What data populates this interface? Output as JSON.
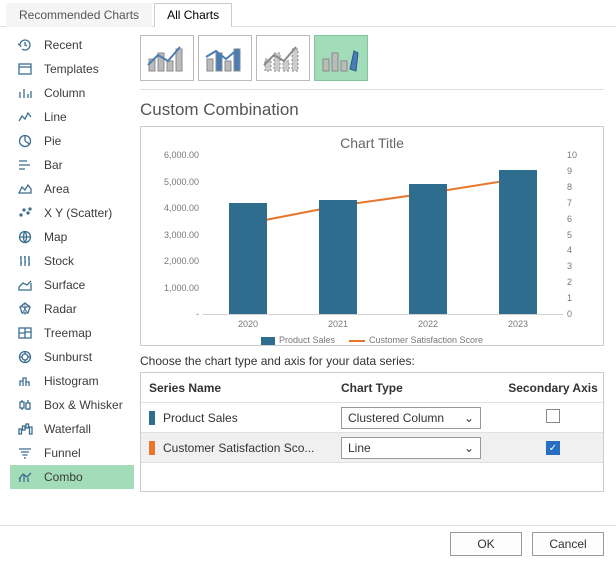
{
  "tabs": {
    "recommended": "Recommended Charts",
    "all": "All Charts"
  },
  "sidebar": {
    "items": [
      {
        "label": "Recent"
      },
      {
        "label": "Templates"
      },
      {
        "label": "Column"
      },
      {
        "label": "Line"
      },
      {
        "label": "Pie"
      },
      {
        "label": "Bar"
      },
      {
        "label": "Area"
      },
      {
        "label": "X Y (Scatter)"
      },
      {
        "label": "Map"
      },
      {
        "label": "Stock"
      },
      {
        "label": "Surface"
      },
      {
        "label": "Radar"
      },
      {
        "label": "Treemap"
      },
      {
        "label": "Sunburst"
      },
      {
        "label": "Histogram"
      },
      {
        "label": "Box & Whisker"
      },
      {
        "label": "Waterfall"
      },
      {
        "label": "Funnel"
      },
      {
        "label": "Combo"
      }
    ]
  },
  "section_title": "Custom Combination",
  "chart_data": {
    "type": "combo",
    "title": "Chart Title",
    "categories": [
      "2020",
      "2021",
      "2022",
      "2023"
    ],
    "series": [
      {
        "name": "Product Sales",
        "type": "bar",
        "axis": "primary",
        "color": "#2f6d8e",
        "values": [
          4180,
          4300,
          4900,
          5430
        ]
      },
      {
        "name": "Customer Satisfaction Score",
        "type": "line",
        "axis": "secondary",
        "color": "#e8762d",
        "values": [
          5.7,
          6.8,
          7.6,
          8.5
        ]
      }
    ],
    "ylim": [
      0,
      6000
    ],
    "yticks": [
      "-",
      "1,000.00",
      "2,000.00",
      "3,000.00",
      "4,000.00",
      "5,000.00",
      "6,000.00"
    ],
    "y2lim": [
      0,
      10
    ],
    "y2ticks": [
      "0",
      "1",
      "2",
      "3",
      "4",
      "5",
      "6",
      "7",
      "8",
      "9",
      "10"
    ],
    "legend": [
      "Product Sales",
      "Customer Satisfaction Score"
    ]
  },
  "instruction": "Choose the chart type and axis for your data series:",
  "table": {
    "headers": {
      "name": "Series Name",
      "type": "Chart Type",
      "axis": "Secondary Axis"
    },
    "rows": [
      {
        "swatch": "#2f6d8e",
        "name": "Product Sales",
        "type": "Clustered Column",
        "secondary": false
      },
      {
        "swatch": "#e8762d",
        "name": "Customer Satisfaction Sco...",
        "type": "Line",
        "secondary": true
      }
    ]
  },
  "footer": {
    "ok": "OK",
    "cancel": "Cancel"
  }
}
